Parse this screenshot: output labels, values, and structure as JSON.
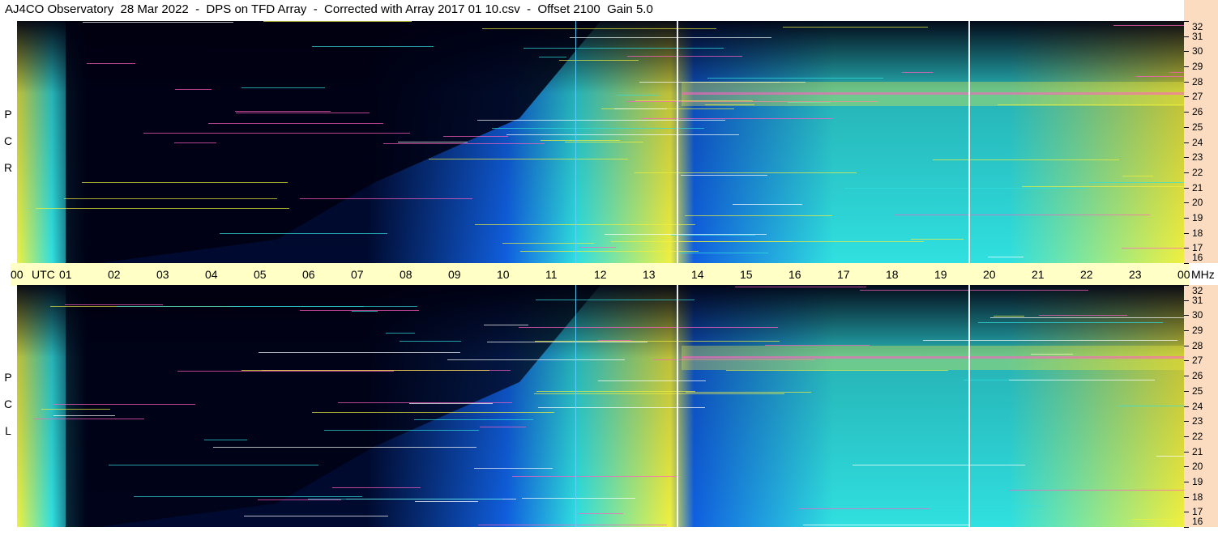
{
  "title": "AJ4CO Observatory  28 Mar 2022  -  DPS on TFD Array  -  Corrected with Array 2017 01 10.csv  -  Offset 2100  Gain 5.0",
  "chart_data": [
    {
      "type": "heatmap",
      "panel": "RCP",
      "polarization_label": [
        "R",
        "C",
        "P"
      ],
      "x_axis_units": "UTC",
      "x_ticks": [
        "00",
        "01",
        "02",
        "03",
        "04",
        "05",
        "06",
        "07",
        "08",
        "09",
        "10",
        "11",
        "12",
        "13",
        "14",
        "15",
        "16",
        "17",
        "18",
        "19",
        "20",
        "21",
        "22",
        "23",
        "00"
      ],
      "y_axis_units": "MHz",
      "y_ticks": [
        16,
        17,
        18,
        19,
        20,
        21,
        22,
        23,
        24,
        25,
        26,
        27,
        28,
        29,
        30,
        31,
        32
      ],
      "ylim": [
        16,
        32
      ]
    },
    {
      "type": "heatmap",
      "panel": "LCP",
      "polarization_label": [
        "L",
        "C",
        "P"
      ],
      "x_axis_units": "UTC",
      "x_ticks": [
        "00",
        "01",
        "02",
        "03",
        "04",
        "05",
        "06",
        "07",
        "08",
        "09",
        "10",
        "11",
        "12",
        "13",
        "14",
        "15",
        "16",
        "17",
        "18",
        "19",
        "20",
        "21",
        "22",
        "23",
        "00"
      ],
      "y_axis_units": "MHz",
      "y_ticks": [
        16,
        17,
        18,
        19,
        20,
        21,
        22,
        23,
        24,
        25,
        26,
        27,
        28,
        29,
        30,
        31,
        32
      ],
      "ylim": [
        16,
        32
      ]
    }
  ],
  "axis": {
    "utc_label": "UTC",
    "mhz_label": "MHz"
  },
  "colors": {
    "background": "#000010",
    "time_axis_bg": "#ffffc6",
    "freq_axis_bg": "#fcdcc0",
    "low": "#000a30",
    "mid": "#1060e0",
    "high": "#30e0e0",
    "peak": "#f0f040",
    "max": "#ff60c0"
  }
}
